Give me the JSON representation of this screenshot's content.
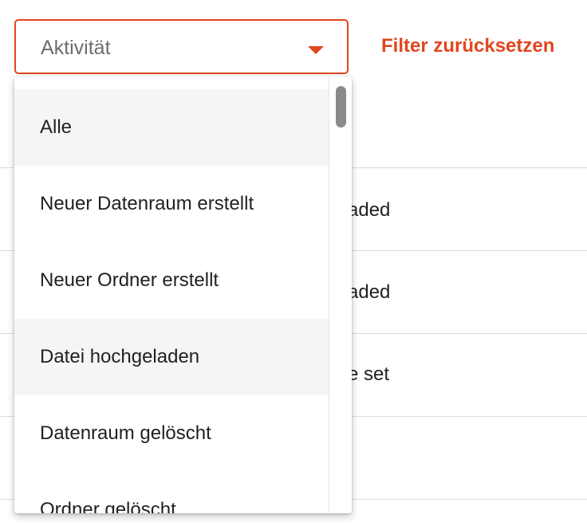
{
  "filter": {
    "select_value": "Aktivität",
    "reset_label": "Filter zurücksetzen",
    "accent_color": "#e1461e"
  },
  "dropdown": {
    "options": [
      {
        "label": "Alle",
        "highlighted": true
      },
      {
        "label": "Neuer Datenraum erstellt",
        "highlighted": false
      },
      {
        "label": "Neuer Ordner erstellt",
        "highlighted": false
      },
      {
        "label": "Datei hochgeladen",
        "highlighted": true
      },
      {
        "label": "Datenraum gelöscht",
        "highlighted": false
      },
      {
        "label": "Ordner gelöscht",
        "highlighted": false
      }
    ]
  },
  "table": {
    "rows": [
      {
        "text": "aded"
      },
      {
        "text": "aded"
      },
      {
        "text": "e set"
      }
    ]
  }
}
